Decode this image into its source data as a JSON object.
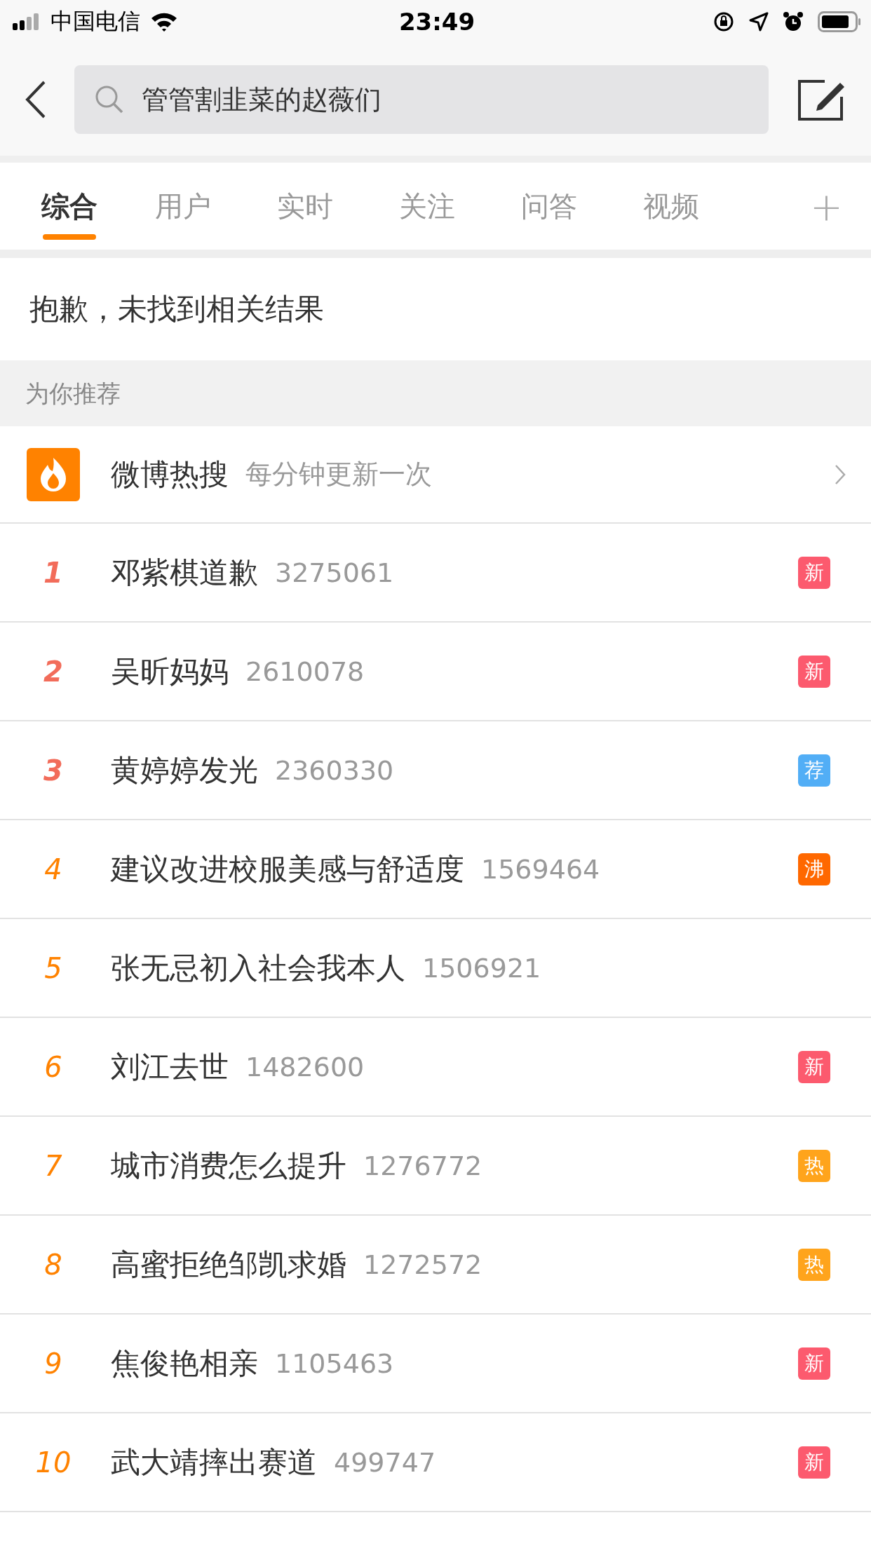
{
  "status_bar": {
    "carrier": "中国电信",
    "time": "23:49"
  },
  "search": {
    "value": "管管割韭菜的赵薇们"
  },
  "tabs": [
    {
      "label": "综合",
      "selected": true
    },
    {
      "label": "用户",
      "selected": false
    },
    {
      "label": "实时",
      "selected": false
    },
    {
      "label": "关注",
      "selected": false
    },
    {
      "label": "问答",
      "selected": false
    },
    {
      "label": "视频",
      "selected": false
    }
  ],
  "tab_more": "+",
  "no_result": "抱歉，未找到相关结果",
  "section_title": "为你推荐",
  "hot_header": {
    "title": "微博热搜",
    "subtitle": "每分钟更新一次"
  },
  "hot_list": [
    {
      "rank": "1",
      "title": "邓紫棋道歉",
      "count": "3275061",
      "badge": "新",
      "color": "#fc5a6e",
      "top": true
    },
    {
      "rank": "2",
      "title": "吴昕妈妈",
      "count": "2610078",
      "badge": "新",
      "color": "#fc5a6e",
      "top": true
    },
    {
      "rank": "3",
      "title": "黄婷婷发光",
      "count": "2360330",
      "badge": "荐",
      "color": "#52aef6",
      "top": true
    },
    {
      "rank": "4",
      "title": "建议改进校服美感与舒适度",
      "count": "1569464",
      "badge": "沸",
      "color": "#ff6800",
      "top": false
    },
    {
      "rank": "5",
      "title": "张无忌初入社会我本人",
      "count": "1506921",
      "top": false
    },
    {
      "rank": "6",
      "title": "刘江去世",
      "count": "1482600",
      "badge": "新",
      "color": "#fc5a6e",
      "top": false
    },
    {
      "rank": "7",
      "title": "城市消费怎么提升",
      "count": "1276772",
      "badge": "热",
      "color": "#ffa41c",
      "top": false
    },
    {
      "rank": "8",
      "title": "高蜜拒绝邹凯求婚",
      "count": "1272572",
      "badge": "热",
      "color": "#ffa41c",
      "top": false
    },
    {
      "rank": "9",
      "title": "焦俊艳相亲",
      "count": "1105463",
      "badge": "新",
      "color": "#fc5a6e",
      "top": false
    },
    {
      "rank": "10",
      "title": "武大靖摔出赛道",
      "count": "499747",
      "badge": "新",
      "color": "#fc5a6e",
      "top": false
    }
  ]
}
